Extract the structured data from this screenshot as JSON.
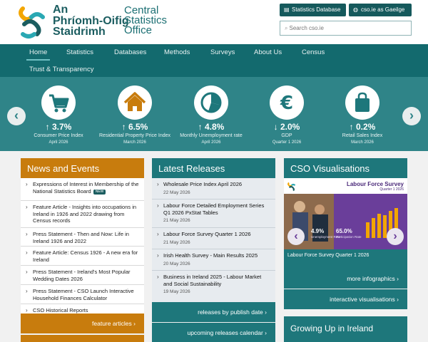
{
  "header": {
    "logo_irish": [
      "An",
      "Phríomh-Oifig",
      "Staidrimh"
    ],
    "logo_english": [
      "Central",
      "Statistics",
      "Office"
    ],
    "btn_database": "Statistics Database",
    "btn_gaeilge": "cso.ie as Gaeilge",
    "search_placeholder": "Search cso.ie"
  },
  "nav": {
    "items": [
      "Home",
      "Statistics",
      "Databases",
      "Methods",
      "Surveys",
      "About Us",
      "Census"
    ],
    "second_row": "Trust & Transparency"
  },
  "stats": [
    {
      "icon": "cart-icon",
      "direction": "up",
      "value": "3.7%",
      "label": "Consumer Price Index",
      "date": "April 2026"
    },
    {
      "icon": "house-icon",
      "direction": "up",
      "value": "6.5%",
      "label": "Residential Property Price Index",
      "date": "March 2026"
    },
    {
      "icon": "pie-icon",
      "direction": "up",
      "value": "4.8%",
      "label": "Monthly Unemployment rate",
      "date": "April 2026"
    },
    {
      "icon": "euro-icon",
      "direction": "down",
      "value": "2.0%",
      "label": "GDP",
      "date": "Quarter 1 2026"
    },
    {
      "icon": "bag-icon",
      "direction": "up",
      "value": "0.2%",
      "label": "Retail Sales Index",
      "date": "March 2026"
    }
  ],
  "news": {
    "title": "News and Events",
    "items": [
      {
        "text": "Expressions of Interest in Membership of the National Statistics Board",
        "badge": "NEW"
      },
      {
        "text": "Feature Article - Insights into occupations in Ireland in 1926 and 2022 drawing from Census records"
      },
      {
        "text": "Press Statement - Then and Now: Life in Ireland 1926 and 2022"
      },
      {
        "text": "Feature Article: Census 1926 - A new era for Ireland"
      },
      {
        "text": "Press Statement - Ireland's Most Popular Wedding Dates 2026"
      },
      {
        "text": "Press Statement - CSO Launch Interactive Household Finances Calculator"
      },
      {
        "text": "CSO Historical Reports"
      }
    ],
    "link": "feature articles"
  },
  "latest": {
    "title": "Latest Releases",
    "items": [
      {
        "text": "Wholesale Price Index April 2026",
        "date": "22 May 2026"
      },
      {
        "text": "Labour Force Detailed Employment Series Q1 2026 PxStat Tables",
        "date": "21 May 2026"
      },
      {
        "text": "Labour Force Survey Quarter 1 2026",
        "date": "21 May 2026"
      },
      {
        "text": "Irish Health Survey - Main Results 2025",
        "date": "20 May 2026"
      },
      {
        "text": "Business in Ireland 2025 - Labour Market and Social Sustainability",
        "date": "19 May 2026"
      }
    ],
    "link1": "releases by publish date",
    "link2": "upcoming releases calendar"
  },
  "visual": {
    "title": "CSO Visualisations",
    "image_title": "Labour Force Survey",
    "image_sub": "Quarter 1 2026",
    "stat1": "4.9%",
    "stat1_label": "Unemployment Rate",
    "stat2": "65.0%",
    "stat2_label": "Participation Rate",
    "caption": "Labour Force Survey Quarter 1 2026",
    "link1": "more infographics",
    "link2": "interactive visualisations",
    "growing": "Growing Up in Ireland"
  },
  "colors": {
    "nav": "#136a6e",
    "band": "#2f8488",
    "teal": "#1e777b",
    "orange": "#c87c0d",
    "purple": "#6a3e9a"
  }
}
